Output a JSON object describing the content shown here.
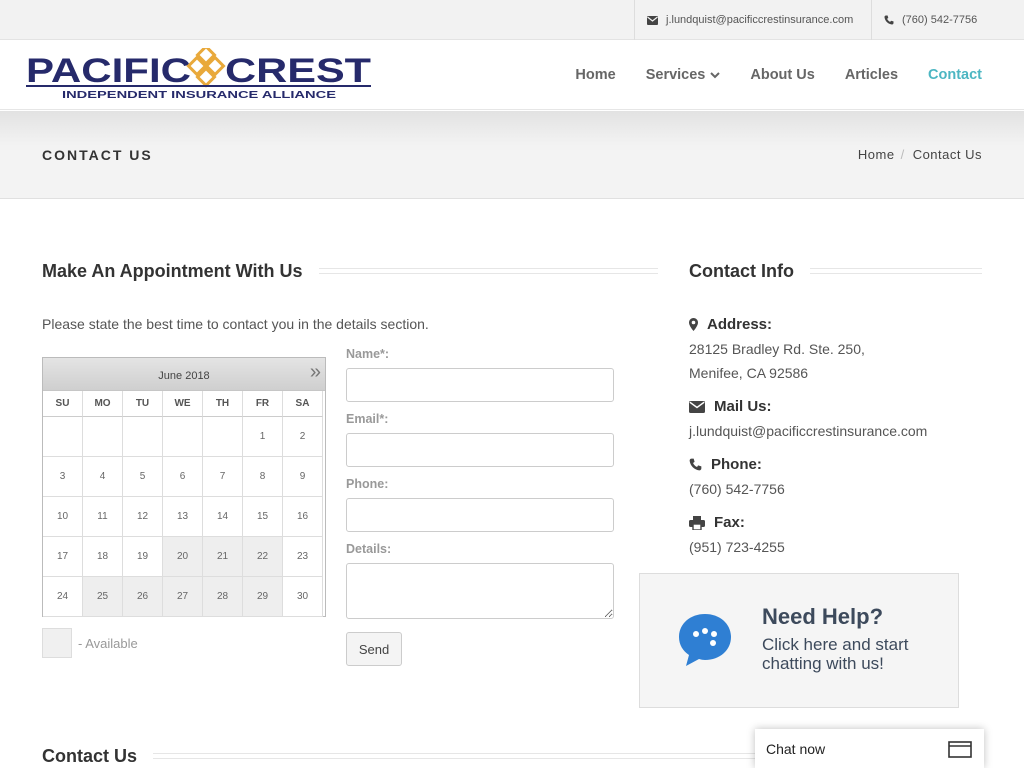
{
  "topbar": {
    "email": "j.lundquist@pacificcrestinsurance.com",
    "phone": "(760) 542-7756"
  },
  "brand": {
    "name_left": "PACIFIC",
    "name_right": "CREST",
    "tagline": "INDEPENDENT INSURANCE ALLIANCE",
    "colors": {
      "navy": "#262a6b",
      "gold": "#e9a93b"
    }
  },
  "nav": {
    "items": [
      {
        "label": "Home"
      },
      {
        "label": "Services"
      },
      {
        "label": "About Us"
      },
      {
        "label": "Articles"
      },
      {
        "label": "Contact"
      }
    ],
    "active_color": "#4cb6c2"
  },
  "page": {
    "title": "CONTACT US",
    "breadcrumb": [
      "Home",
      "Contact Us"
    ]
  },
  "appointment": {
    "heading": "Make An Appointment With Us",
    "intro": "Please state the best time to contact you in the details section.",
    "calendar": {
      "month": "June 2018",
      "next": "»",
      "weekdays": [
        "SU",
        "MO",
        "TU",
        "WE",
        "TH",
        "FR",
        "SA"
      ],
      "weeks": [
        [
          "",
          "",
          "",
          "",
          "",
          "1",
          "2"
        ],
        [
          "3",
          "4",
          "5",
          "6",
          "7",
          "8",
          "9"
        ],
        [
          "10",
          "11",
          "12",
          "13",
          "14",
          "15",
          "16"
        ],
        [
          "17",
          "18",
          "19",
          "20",
          "21",
          "22",
          "23"
        ],
        [
          "24",
          "25",
          "26",
          "27",
          "28",
          "29",
          "30"
        ]
      ],
      "available": [
        "20",
        "21",
        "22",
        "25",
        "26",
        "27",
        "28",
        "29"
      ]
    },
    "legend": "- Available",
    "form": {
      "name_label": "Name*:",
      "email_label": "Email*:",
      "phone_label": "Phone:",
      "details_label": "Details:",
      "name_value": "",
      "email_value": "",
      "phone_value": "",
      "details_value": "",
      "send_label": "Send"
    }
  },
  "contact_info": {
    "heading": "Contact Info",
    "address_label": "Address:",
    "address_line1": "28125 Bradley Rd. Ste. 250,",
    "address_line2": "Menifee, CA 92586",
    "mail_label": "Mail Us:",
    "mail_value": "j.lundquist@pacificcrestinsurance.com",
    "phone_label": "Phone:",
    "phone_value": "(760) 542-7756",
    "fax_label": "Fax:",
    "fax_value": "(951) 723-4255",
    "icons": [
      "map-marker-icon",
      "envelope-icon",
      "phone-icon",
      "printer-icon"
    ]
  },
  "help_box": {
    "title": "Need Help?",
    "subtitle": "Click here and start chatting with us!",
    "bubble_color": "#2f7fd3"
  },
  "bottom": {
    "heading": "Contact Us"
  },
  "chat_widget": {
    "label": "Chat now"
  }
}
